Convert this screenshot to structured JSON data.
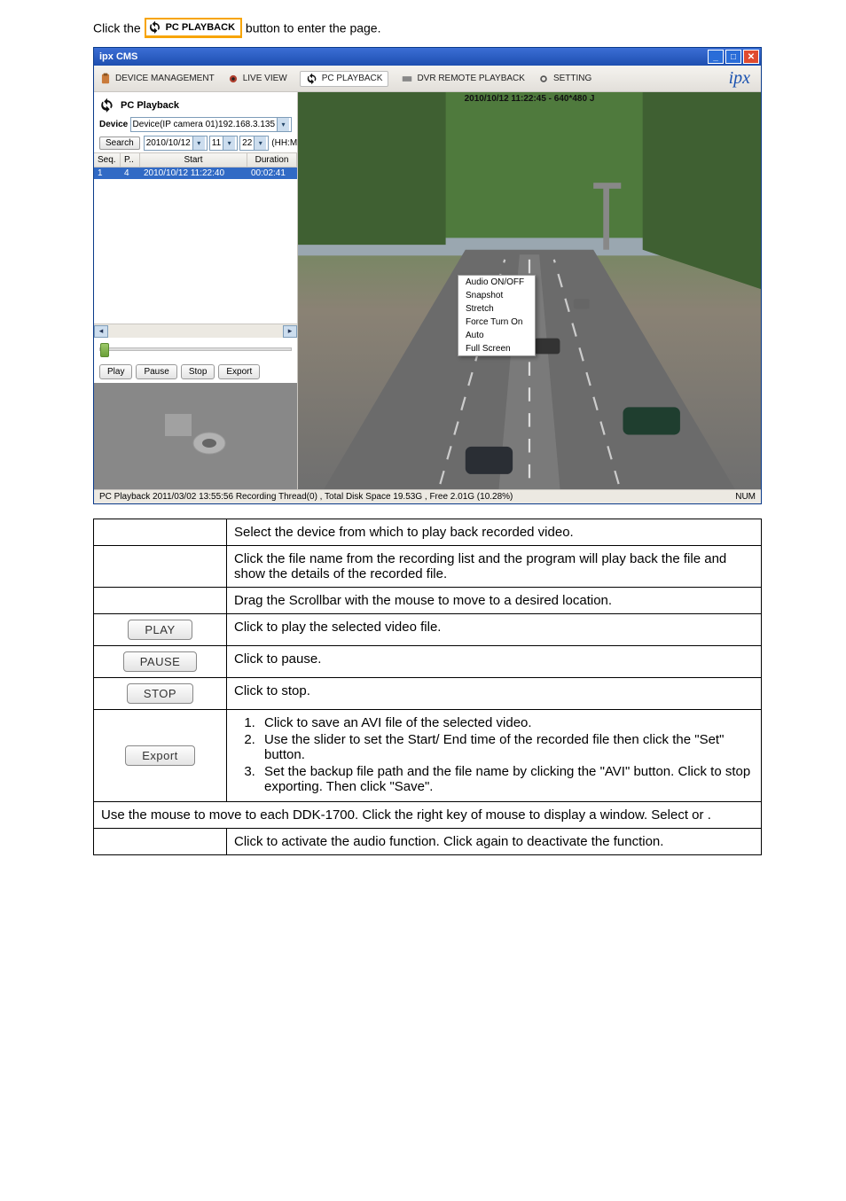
{
  "intro": {
    "pre": "Click the ",
    "btn_label": "PC PLAYBACK",
    "mid": " button to enter the ",
    "post": " page."
  },
  "app": {
    "title": "ipx CMS",
    "brand": "ipx",
    "toolbar": {
      "dev_mgmt": "DEVICE MANAGEMENT",
      "live": "LIVE VIEW",
      "pc_pb": "PC PLAYBACK",
      "dvr_pb": "DVR REMOTE PLAYBACK",
      "setting": "SETTING"
    },
    "panel": {
      "title": "PC Playback",
      "device_lbl": "Device",
      "device_val": "Device(IP camera 01)192.168.3.135",
      "search_btn": "Search",
      "date": "2010/10/12",
      "hh": "11",
      "mm": "22",
      "hhmm": "(HH:MM)",
      "hdr_seq": "Seq.",
      "hdr_p": "P..",
      "hdr_start": "Start",
      "hdr_dur": "Duration",
      "row_seq": "1",
      "row_p": "4",
      "row_start": "2010/10/12 11:22:40",
      "row_dur": "00:02:41",
      "play": "Play",
      "pause": "Pause",
      "stop": "Stop",
      "export": "Export"
    },
    "caption": "2010/10/12 11:22:45 - 640*480 J",
    "ctx": {
      "audio": "Audio ON/OFF",
      "snap": "Snapshot",
      "stretch": "Stretch",
      "force": "Force Turn On",
      "auto": "Auto",
      "full": "Full Screen"
    },
    "status_left": "PC Playback  2011/03/02 13:55:56  Recording Thread(0) , Total Disk Space 19.53G , Free 2.01G (10.28%)",
    "status_right": "NUM"
  },
  "tbl": {
    "r1": "Select the device from which to play back recorded video.",
    "r2": "Click the file name from the recording list and the program will play back the file and show the details of the recorded file.",
    "r3": "Drag the Scrollbar with the mouse to move to a desired location.",
    "play_lbl": "PLAY",
    "r4": "Click to play the selected video file.",
    "pause_lbl": "PAUSE",
    "r5": "Click to pause.",
    "stop_lbl": "STOP",
    "r6": "Click to stop.",
    "export_lbl": "Export",
    "r7a": "Click to save an AVI file of the selected video.",
    "r7b": "Use the slider to set the Start/ End time of the recorded file then click the \"Set\" button.",
    "r7c": "Set the backup file path and the file name by clicking the \"AVI\" button. Click to stop exporting. Then click \"Save\".",
    "r8a": "Use the mouse to move to each DDK-1700. Click the right key of mouse to display a window. Select ",
    "r8b": " or ",
    "r8c": ".",
    "r9": "Click to activate the audio function. Click again to deactivate the function."
  }
}
